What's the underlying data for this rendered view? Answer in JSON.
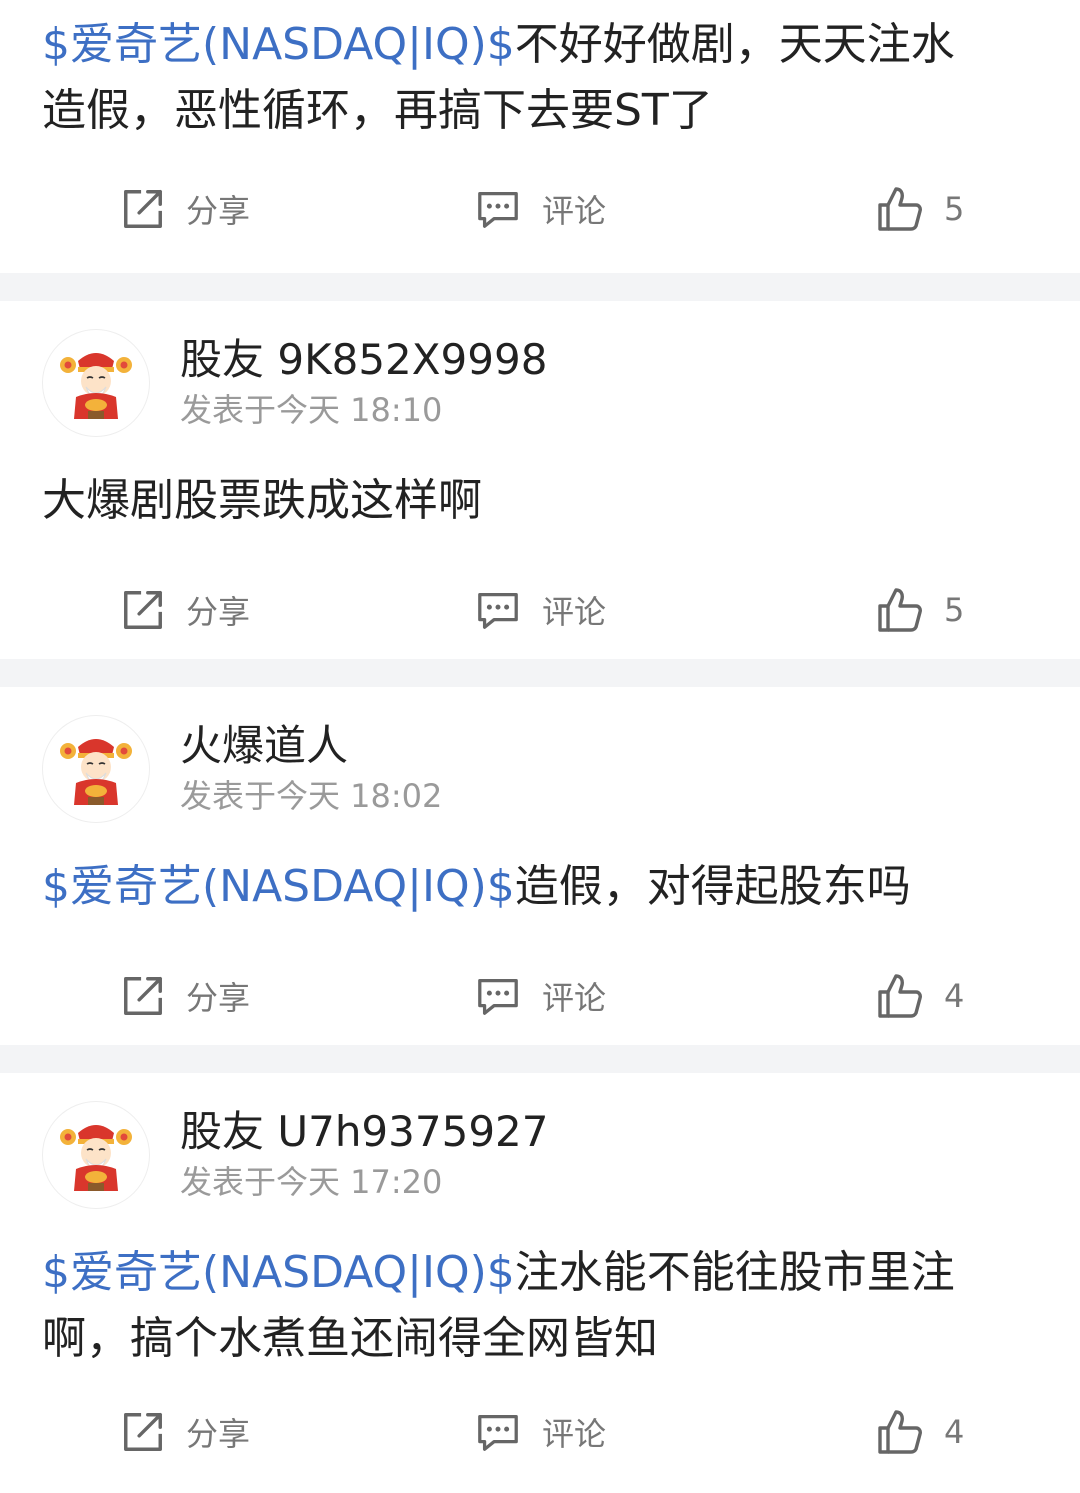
{
  "actions": {
    "share": "分享",
    "comment": "评论"
  },
  "posts": [
    {
      "tag": "$爱奇艺(NASDAQ|IQ)$",
      "text_line1": "不好好做剧，天天注水",
      "text_line2": "造假，恶性循环，再搞下去要ST了",
      "likes": "5"
    },
    {
      "author": "股友 9K852X9998",
      "time": "发表于今天 18:10",
      "text": "大爆剧股票跌成这样啊",
      "likes": "5"
    },
    {
      "author": "火爆道人",
      "time": "发表于今天 18:02",
      "tag": "$爱奇艺(NASDAQ|IQ)$",
      "text": "造假，对得起股东吗",
      "likes": "4"
    },
    {
      "author": "股友 U7h9375927",
      "time": "发表于今天 17:20",
      "tag": "$爱奇艺(NASDAQ|IQ)$",
      "text_line1": "注水能不能往股市里注",
      "text_line2": "啊，搞个水煮鱼还闹得全网皆知",
      "likes": "4"
    }
  ],
  "colors": {
    "tag": "#3d6fc4",
    "separator": "#f3f4f6",
    "muted": "#9a9a9a"
  }
}
